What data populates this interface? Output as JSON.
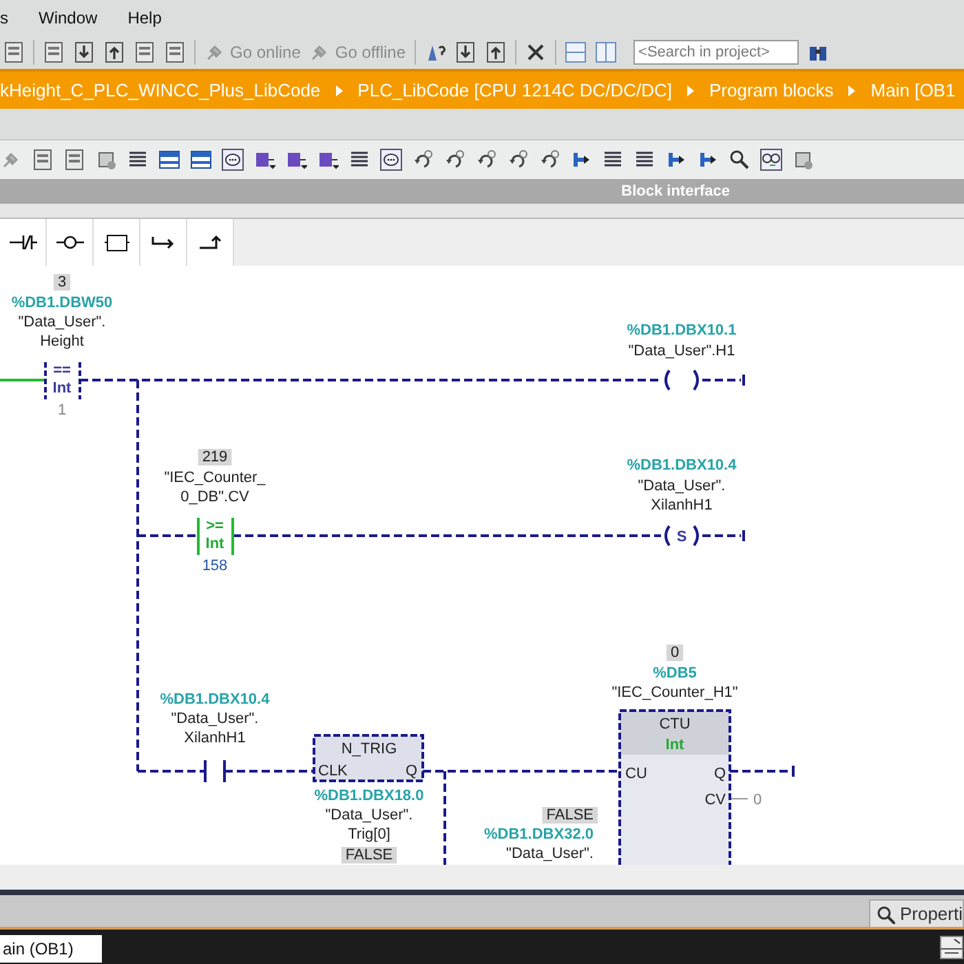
{
  "menu": [
    "s",
    "Window",
    "Help"
  ],
  "toolbar": {
    "buttons": [
      {
        "label": "Go online",
        "disabled": true
      },
      {
        "label": "Go offline",
        "disabled": true
      }
    ],
    "search": {
      "placeholder": "<Search in project>"
    }
  },
  "breadcrumb": [
    "kHeight_C_PLC_WINCC_Plus_LibCode",
    "PLC_LibCode [CPU 1214C DC/DC/DC]",
    "Program blocks",
    "Main [OB1"
  ],
  "block_interface": "Block interface",
  "network": {
    "elements": [
      {
        "kind": "compare",
        "operator": "==",
        "type": "Int",
        "live_value": "3",
        "address": "%DB1.DBW50",
        "operand": [
          "\"Data_User\".",
          "Height"
        ],
        "operand2": "1",
        "powered": false
      },
      {
        "kind": "coil",
        "address": "%DB1.DBX10.1",
        "operand": [
          "\"Data_User\".H1"
        ]
      },
      {
        "kind": "compare",
        "operator": ">=",
        "type": "Int",
        "live_value": "219",
        "operand": [
          "\"IEC_Counter_",
          "0_DB\".CV"
        ],
        "operand2": "158",
        "powered": true
      },
      {
        "kind": "coil",
        "symbol": "S",
        "address": "%DB1.DBX10.4",
        "operand": [
          "\"Data_User\".",
          "XilanhH1"
        ]
      },
      {
        "kind": "contact",
        "address": "%DB1.DBX10.4",
        "operand": [
          "\"Data_User\".",
          "XilanhH1"
        ]
      },
      {
        "kind": "edge_box",
        "title": "N_TRIG",
        "input": "CLK",
        "output": "Q",
        "address": "%DB1.DBX18.0",
        "operand": [
          "\"Data_User\".",
          "Trig[0]"
        ],
        "live_value": "FALSE"
      },
      {
        "kind": "counter",
        "title": "CTU",
        "type": "Int",
        "live_value": "0",
        "address": "%DB5",
        "instance": "\"IEC_Counter_H1\"",
        "input": "CU",
        "outputs": [
          "Q",
          "CV"
        ],
        "cv_value": "0"
      },
      {
        "kind": "operand",
        "live_value": "FALSE",
        "address": "%DB1.DBX32.0",
        "operand": [
          "\"Data_User\"."
        ]
      }
    ]
  },
  "properties_button": "Properti",
  "editor_tab": "ain (OB1)"
}
